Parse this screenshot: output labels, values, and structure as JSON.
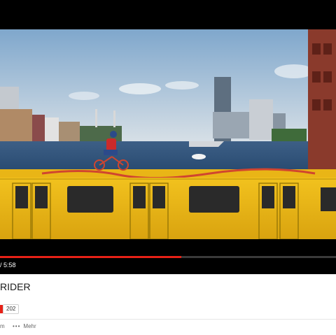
{
  "player": {
    "time_display": "/ 5:58",
    "progress_fraction": 0.54,
    "progress_color": "#e62117"
  },
  "video": {
    "title": "RIDER",
    "like_count": "202"
  },
  "actions": {
    "left_fragment": "m",
    "more_label": "Mehr",
    "more_icon": "more-dots-icon"
  }
}
